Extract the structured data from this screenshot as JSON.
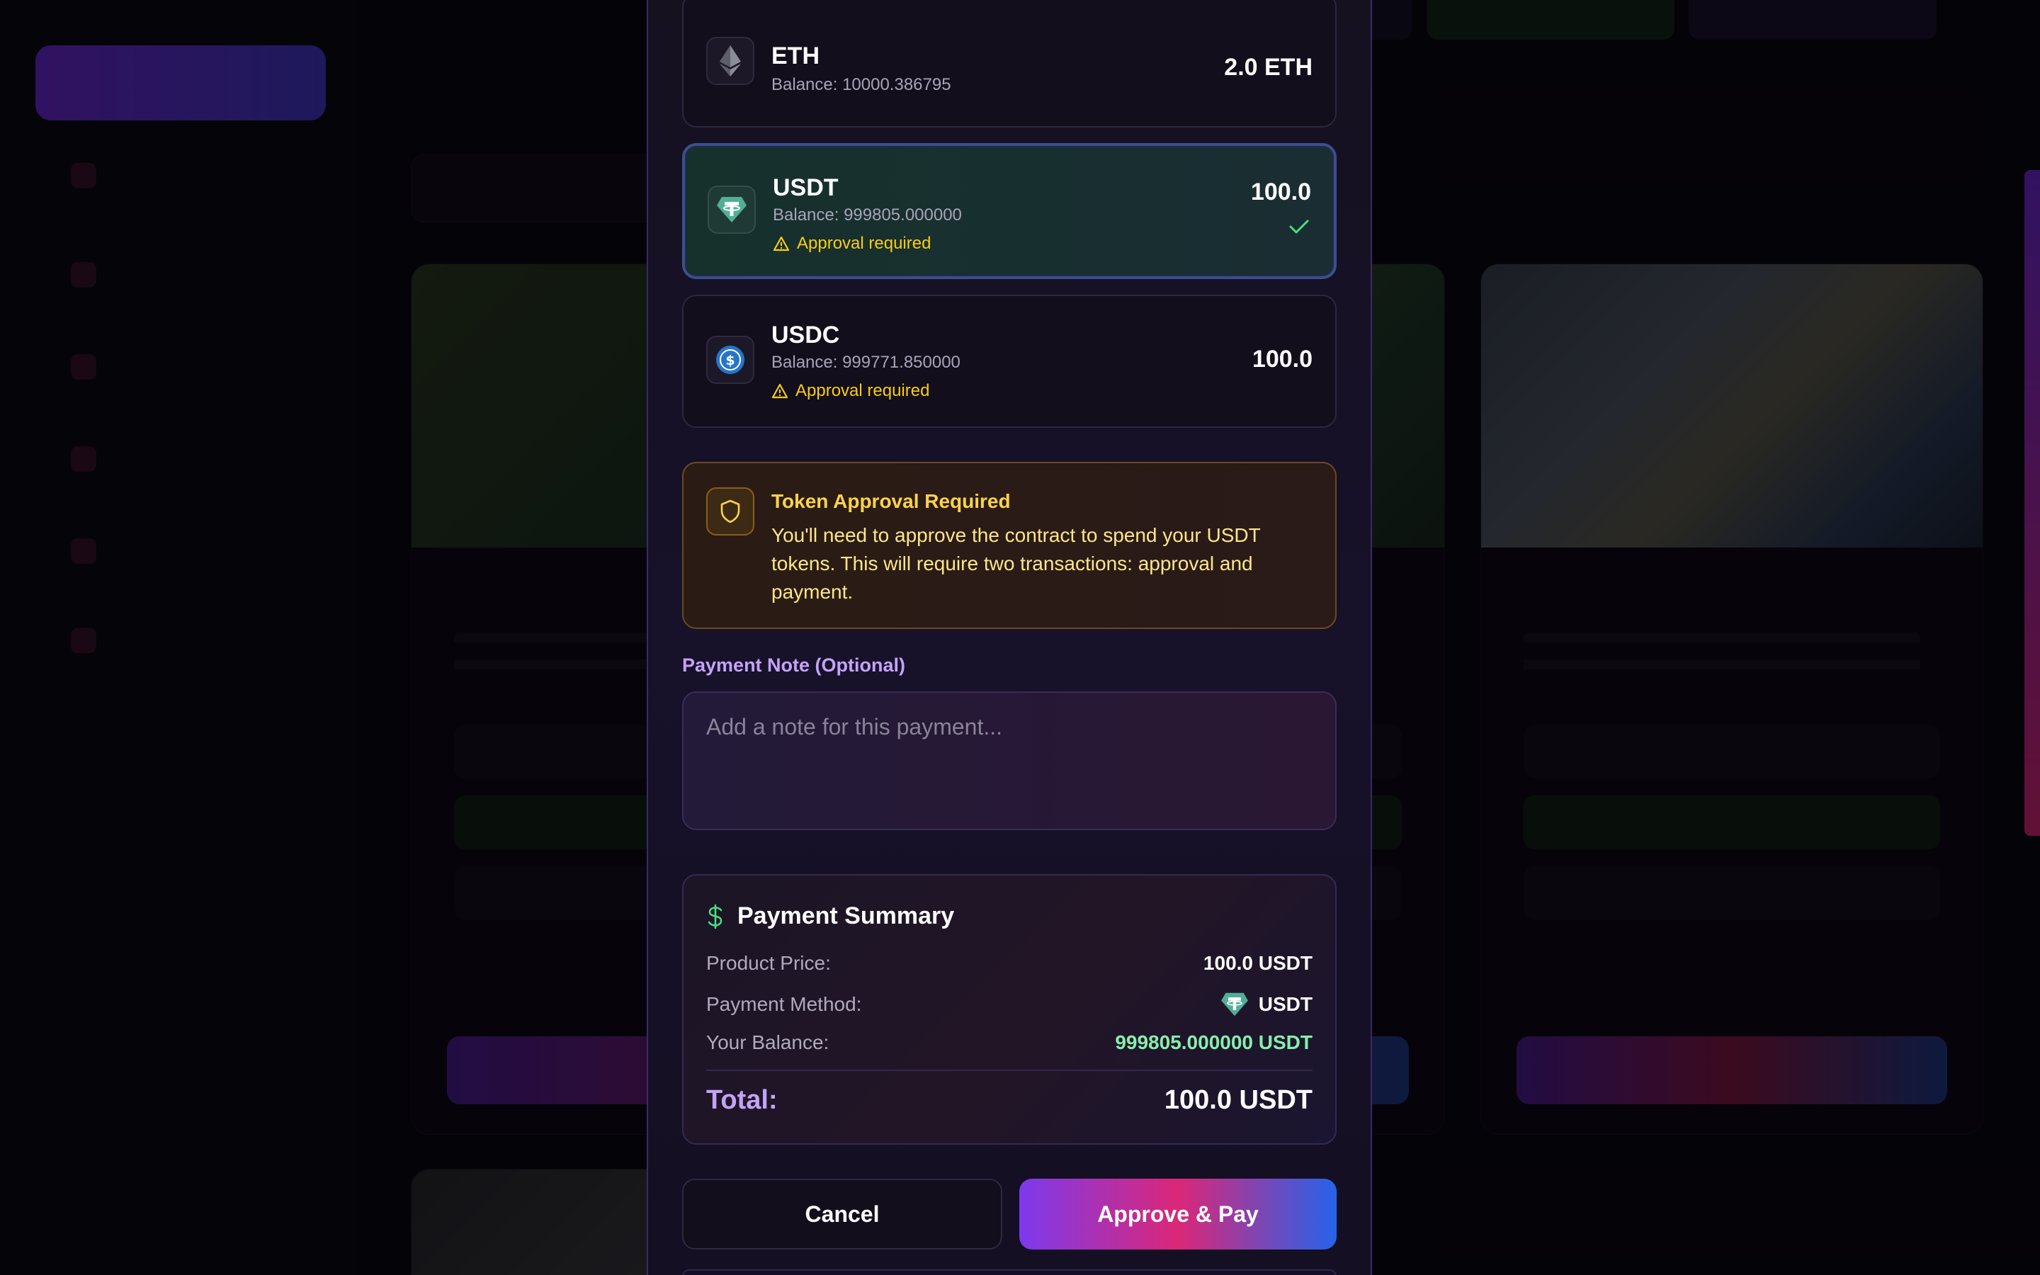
{
  "tokens": [
    {
      "symbol": "ETH",
      "balance": "Balance: 10000.386795",
      "amount": "2.0 ETH",
      "approval": ""
    },
    {
      "symbol": "USDT",
      "balance": "Balance: 999805.000000",
      "amount": "100.0",
      "approval": "Approval required",
      "selected": true
    },
    {
      "symbol": "USDC",
      "balance": "Balance: 999771.850000",
      "amount": "100.0",
      "approval": "Approval required"
    }
  ],
  "warning": {
    "title": "Token Approval Required",
    "text": "You'll need to approve the contract to spend your USDT tokens. This will require two transactions: approval and payment."
  },
  "note": {
    "label": "Payment Note (Optional)",
    "placeholder": "Add a note for this payment..."
  },
  "summary": {
    "title": "Payment Summary",
    "price_label": "Product Price:",
    "price_value": "100.0 USDT",
    "method_label": "Payment Method:",
    "method_value": "USDT",
    "balance_label": "Your Balance:",
    "balance_value": "999805.000000 USDT",
    "total_label": "Total:",
    "total_value": "100.0 USDT"
  },
  "buttons": {
    "cancel": "Cancel",
    "approve": "Approve & Pay"
  },
  "icons": {
    "eth": "ethereum-icon",
    "usdt": "tether-icon",
    "usdc": "usdc-icon",
    "shield": "shield-icon",
    "warning": "warning-triangle-icon",
    "check": "check-icon",
    "dollar": "dollar-icon"
  },
  "colors": {
    "accent_purple": "#c4a3f7",
    "warning_yellow": "#facc15",
    "success_green": "#86efac",
    "gradient_start": "#7c3aed",
    "gradient_mid": "#db2777",
    "gradient_end": "#2563eb"
  }
}
